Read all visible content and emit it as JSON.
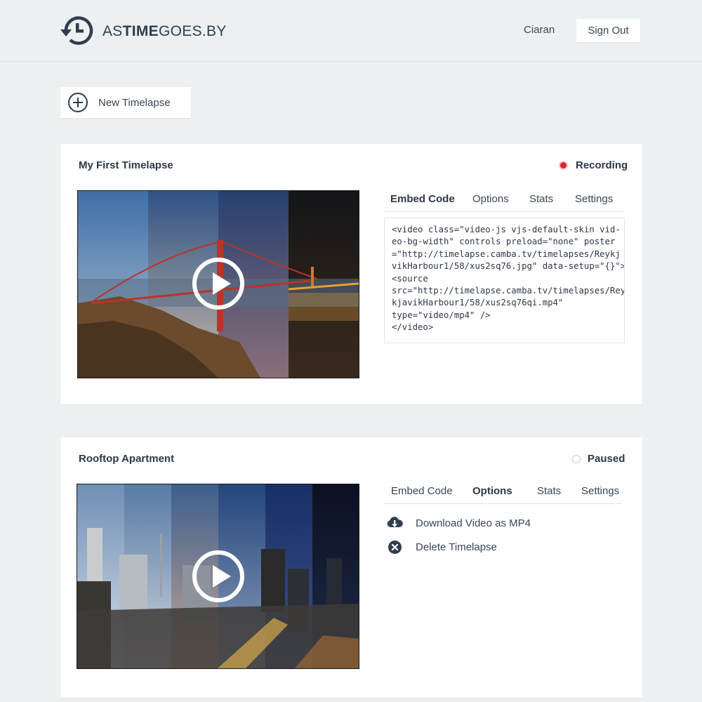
{
  "header": {
    "logo_parts": [
      "AS",
      "TIME",
      "GOES.BY"
    ],
    "user_name": "Ciaran",
    "sign_out_label": "Sign Out"
  },
  "actions": {
    "new_timelapse_label": "New Timelapse"
  },
  "timelapses": [
    {
      "title": "My First Timelapse",
      "status": "Recording",
      "status_color": "#e0242f",
      "tabs": [
        "Embed Code",
        "Options",
        "Stats",
        "Settings"
      ],
      "active_tab": "Embed Code",
      "embed_code": [
        "<video class=\"video-js vjs-default-skin vid-",
        "eo-bg-width\" controls preload=\"none\" poster",
        "=\"http://timelapse.camba.tv/timelapses/Reykj",
        "vikHarbour1/58/xus2sq76.jpg\" data-setup=\"{}\">",
        "<source",
        "src=\"http://timelapse.camba.tv/timelapses/Rey",
        "kjavikHarbour1/58/xus2sq76qi.mp4\"",
        "type=\"video/mp4\" />",
        "</video>"
      ]
    },
    {
      "title": "Rooftop Apartment",
      "status": "Paused",
      "tabs": [
        "Embed Code",
        "Options",
        "Stats",
        "Settings"
      ],
      "active_tab": "Options",
      "options": [
        {
          "label": "Download Video as MP4",
          "icon": "cloud-download-icon"
        },
        {
          "label": "Delete Timelapse",
          "icon": "delete-icon"
        }
      ]
    }
  ],
  "colors": {
    "background": "#edf0f1",
    "text": "#2d3848",
    "recording": "#e0242f"
  }
}
